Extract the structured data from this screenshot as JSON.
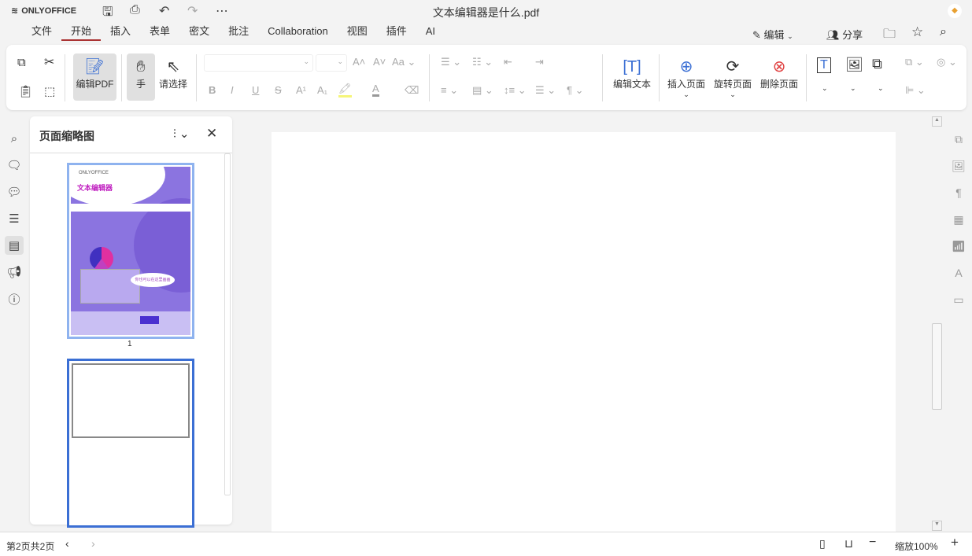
{
  "app": {
    "logo": "ONLYOFFICE",
    "title": "文本编辑器是什么.pdf"
  },
  "menu": {
    "tabs": [
      "文件",
      "开始",
      "插入",
      "表单",
      "密文",
      "批注",
      "Collaboration",
      "视图",
      "插件",
      "AI"
    ],
    "active": "开始"
  },
  "header_right": {
    "edit_label": "编辑",
    "share_label": "分享"
  },
  "toolbar": {
    "edit_pdf": "编辑PDF",
    "hand": "手",
    "select": "请选择",
    "edit_text": "编辑文本",
    "insert_page": "插入页面",
    "rotate_page": "旋转页面",
    "delete_page": "删除页面"
  },
  "panel": {
    "title": "页面缩略图",
    "page1_label": "1",
    "thumb_logo": "ONLYOFFICE",
    "thumb_title": "文本编辑器",
    "thumb_bubble": "你也可以在这里画画"
  },
  "status": {
    "page_info": "第2页共2页",
    "zoom": "缩放100%"
  },
  "colors": {
    "accent": "#a33a3a",
    "thumb_purple": "#8b74e0",
    "selected_border": "#3b6fd4"
  }
}
